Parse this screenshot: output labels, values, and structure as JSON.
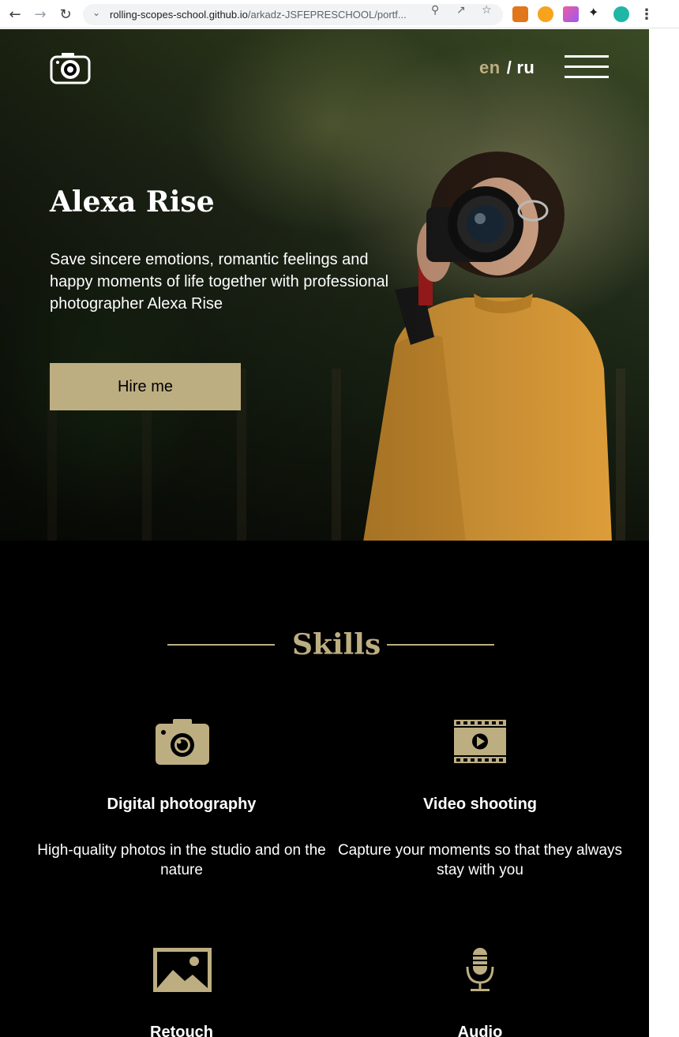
{
  "browser": {
    "url_host": "rolling-scopes-school.github.io",
    "url_path": "/arkadz-JSFEPRESCHOOL/portf..."
  },
  "header": {
    "lang_en": "en",
    "lang_separator": "/",
    "lang_ru": "ru"
  },
  "hero": {
    "title": "Alexa Rise",
    "text": "Save sincere emotions, romantic feelings and happy moments of life together with professional photographer Alexa Rise",
    "button_label": "Hire me"
  },
  "skills": {
    "section_title": "Skills",
    "items": [
      {
        "icon": "camera-icon",
        "title": "Digital photography",
        "text": "High-quality photos in the studio and on the nature"
      },
      {
        "icon": "video-icon",
        "title": "Video shooting",
        "text": "Capture your moments so that they always stay with you"
      },
      {
        "icon": "image-icon",
        "title": "Retouch",
        "text": ""
      },
      {
        "icon": "microphone-icon",
        "title": "Audio",
        "text": ""
      }
    ]
  },
  "colors": {
    "accent": "#bdae82",
    "background": "#000000",
    "text": "#ffffff"
  }
}
